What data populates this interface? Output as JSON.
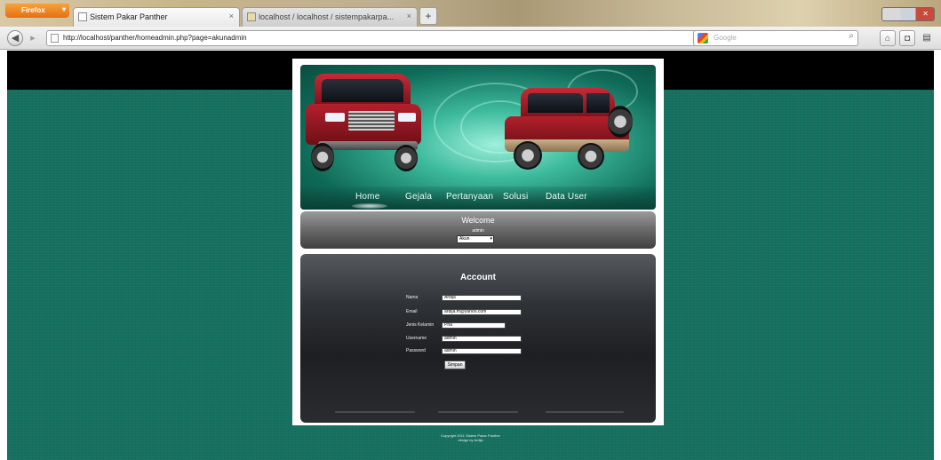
{
  "browser": {
    "app_button": "Firefox",
    "tabs": [
      {
        "title": "Sistem Pakar Panther"
      },
      {
        "title": "localhost / localhost / sistempakarpa..."
      }
    ],
    "url": "http://localhost/panther/homeadmin.php?page=akunadmin",
    "search_placeholder": "Google"
  },
  "site": {
    "menu": [
      {
        "label": "Home"
      },
      {
        "label": "Gejala"
      },
      {
        "label": "Pertanyaan"
      },
      {
        "label": "Solusi"
      },
      {
        "label": "Data User"
      }
    ],
    "welcome": {
      "title": "Welcome",
      "user": "admin",
      "select_value": "Akun"
    },
    "account": {
      "title": "Account",
      "fields": [
        {
          "label": "Nama",
          "value": "Ardija"
        },
        {
          "label": "Email",
          "value": "ardija.m@yahoo.com"
        },
        {
          "label": "Jenis Kelamin",
          "value": "Pria"
        },
        {
          "label": "Username",
          "value": "admin"
        },
        {
          "label": "Password",
          "value": "admin"
        }
      ],
      "submit_label": "Simpan"
    },
    "footer": {
      "line1": "Copyright 2011 Sistem Pakar Panther",
      "line2": "design by Ardija"
    }
  },
  "colors": {
    "background": "#17705f",
    "top_band": "#000000",
    "content_box": "#1d1f22"
  },
  "icons": [
    "back-icon",
    "forward-icon",
    "page-icon",
    "star-icon",
    "reload-icon",
    "search-icon",
    "home-icon"
  ]
}
